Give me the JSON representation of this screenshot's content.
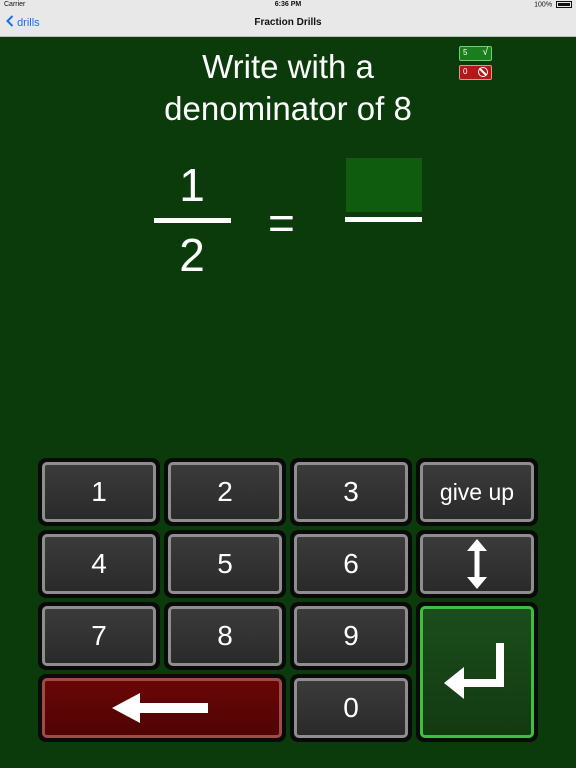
{
  "status_bar": {
    "carrier": "Carrier",
    "time": "6:36 PM",
    "battery": "100%"
  },
  "nav": {
    "back_label": "drills",
    "title": "Fraction Drills"
  },
  "prompt": {
    "line1": "Write with a",
    "line2": "denominator of 8"
  },
  "score": {
    "correct": "5",
    "correct_icon": "√",
    "wrong": "0"
  },
  "fraction": {
    "numerator": "1",
    "denominator": "2",
    "equals": "="
  },
  "keypad": {
    "keys": [
      "1",
      "2",
      "3",
      "4",
      "5",
      "6",
      "7",
      "8",
      "9",
      "0"
    ],
    "give_up": "give up",
    "toggle_icon": "↕",
    "enter_icon": "↵",
    "backspace_icon": "⟵"
  }
}
